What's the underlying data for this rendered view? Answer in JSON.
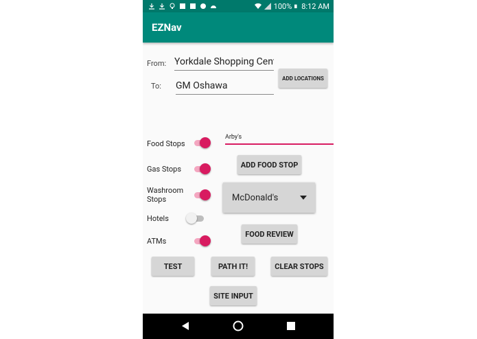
{
  "status_bar": {
    "battery": "100%",
    "time": "8:12 AM",
    "icons": [
      "download-icon",
      "download-icon",
      "bulb-icon",
      "image-icon",
      "image-icon",
      "circle-icon",
      "android-icon",
      "wifi-icon",
      "signal-icon",
      "battery-icon"
    ]
  },
  "app": {
    "title": "EZNav"
  },
  "form": {
    "from_label": "From:",
    "from_value": "Yorkdale Shopping Cent",
    "to_label": "To:",
    "to_value": "GM Oshawa",
    "add_locations": "ADD LOCATIONS"
  },
  "stops": [
    {
      "label": "Food Stops",
      "on": true
    },
    {
      "label": "Gas Stops",
      "on": true
    },
    {
      "label": "Washroom\nStops",
      "on": true
    },
    {
      "label": "Hotels",
      "on": false
    },
    {
      "label": "ATMs",
      "on": true
    }
  ],
  "food_input": {
    "value": "Arby's"
  },
  "buttons": {
    "add_food_stop": "ADD FOOD STOP",
    "food_review": "FOOD REVIEW",
    "test": "TEST",
    "path_it": "PATH IT!",
    "clear_stops": "CLEAR STOPS",
    "site_input": "SITE INPUT"
  },
  "spinner": {
    "selected": "McDonald's"
  },
  "colors": {
    "primary": "#00897b",
    "status": "#00796b",
    "accent": "#d81b60"
  }
}
